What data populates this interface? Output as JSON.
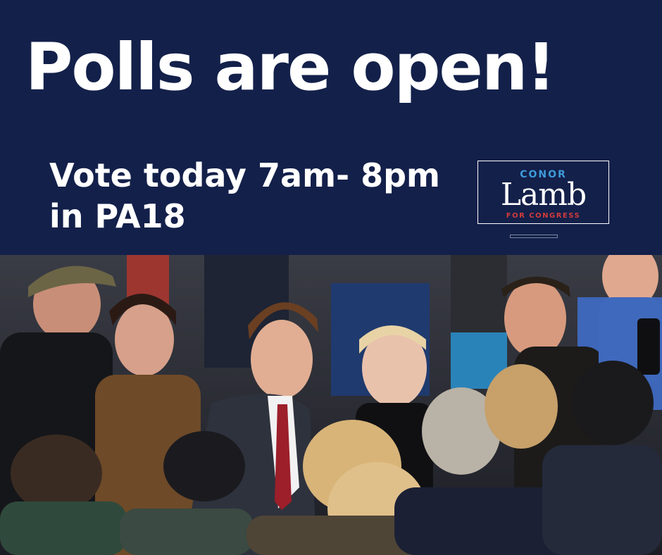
{
  "headline": "Polls are open!",
  "subline": {
    "line1": "Vote today 7am- 8pm",
    "line2": "in PA18"
  },
  "logo": {
    "first_name": "CONOR",
    "last_name": "Lamb",
    "tagline": "FOR CONGRESS"
  },
  "colors": {
    "banner_background": "#13204a",
    "headline_text": "#ffffff",
    "logo_first_name": "#3e9ad9",
    "logo_tagline": "#d23b3b"
  },
  "photo": {
    "subject": "crowd-photo"
  }
}
